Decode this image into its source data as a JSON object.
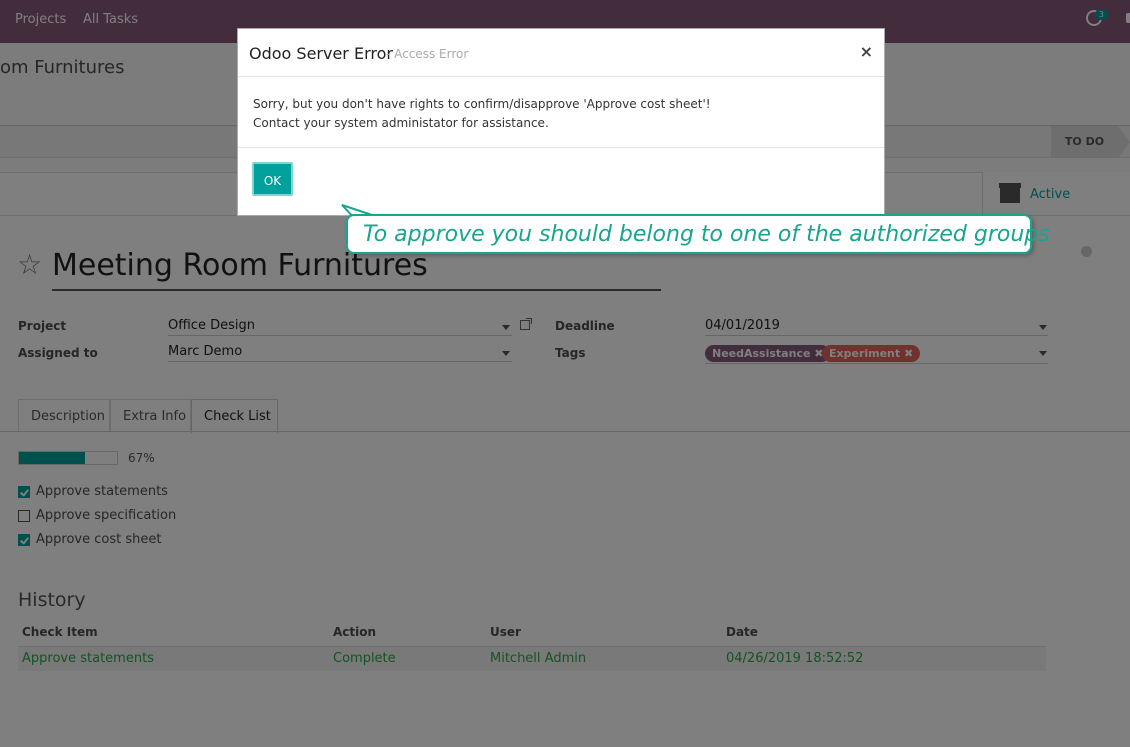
{
  "topbar": {
    "menu": [
      "Projects",
      "All Tasks"
    ],
    "activity_count": "3"
  },
  "breadcrumb": "om Furnitures",
  "status": {
    "stage": "TO DO"
  },
  "smart_button": {
    "label": "Active"
  },
  "task": {
    "title": "Meeting Room Furnitures",
    "project_label": "Project",
    "project": "Office Design",
    "assigned_label": "Assigned to",
    "assigned": "Marc Demo",
    "deadline_label": "Deadline",
    "deadline": "04/01/2019",
    "tags_label": "Tags",
    "tags": [
      {
        "name": "NeedAssistance ✖",
        "color": "#875a7b"
      },
      {
        "name": "Experiment ✖",
        "color": "#e0655a"
      }
    ]
  },
  "tabs": [
    "Description",
    "Extra Info",
    "Check List"
  ],
  "checklist": {
    "progress_percent": 67,
    "progress_label": "67%",
    "items": [
      {
        "label": "Approve statements",
        "checked": true
      },
      {
        "label": "Approve specification",
        "checked": false
      },
      {
        "label": "Approve cost sheet",
        "checked": true
      }
    ]
  },
  "history": {
    "title": "History",
    "headers": [
      "Check Item",
      "Action",
      "User",
      "Date"
    ],
    "rows": [
      [
        "Approve statements",
        "Complete",
        "Mitchell Admin",
        "04/26/2019 18:52:52"
      ]
    ]
  },
  "dialog": {
    "title": "Odoo Server Error",
    "subtitle": "- Access Error",
    "close": "×",
    "line1": "Sorry, but you don't have rights to confirm/disapprove 'Approve cost sheet'!",
    "line2": "Contact your system administator for assistance.",
    "ok": "OK"
  },
  "callout": "To approve you should belong to one of the authorized groups"
}
